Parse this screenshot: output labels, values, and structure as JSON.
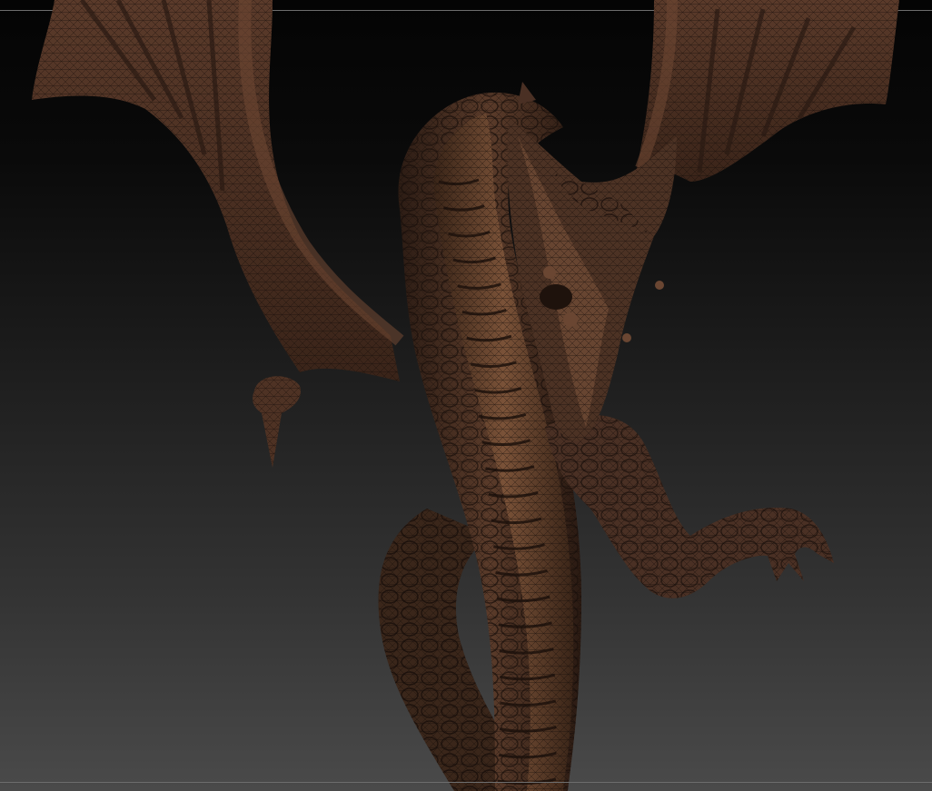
{
  "viewport": {
    "background_top": "#040404",
    "background_bottom": "#4a4a4a",
    "frame_line_color": "#6d6d6d"
  },
  "model": {
    "subject": "dragon-sculpt",
    "display_mode": "wireframe-overlay",
    "material_color": "#4a3024",
    "highlight_color": "#7a5238",
    "shadow_color": "#1e120c",
    "wire_color": "#120b08"
  }
}
